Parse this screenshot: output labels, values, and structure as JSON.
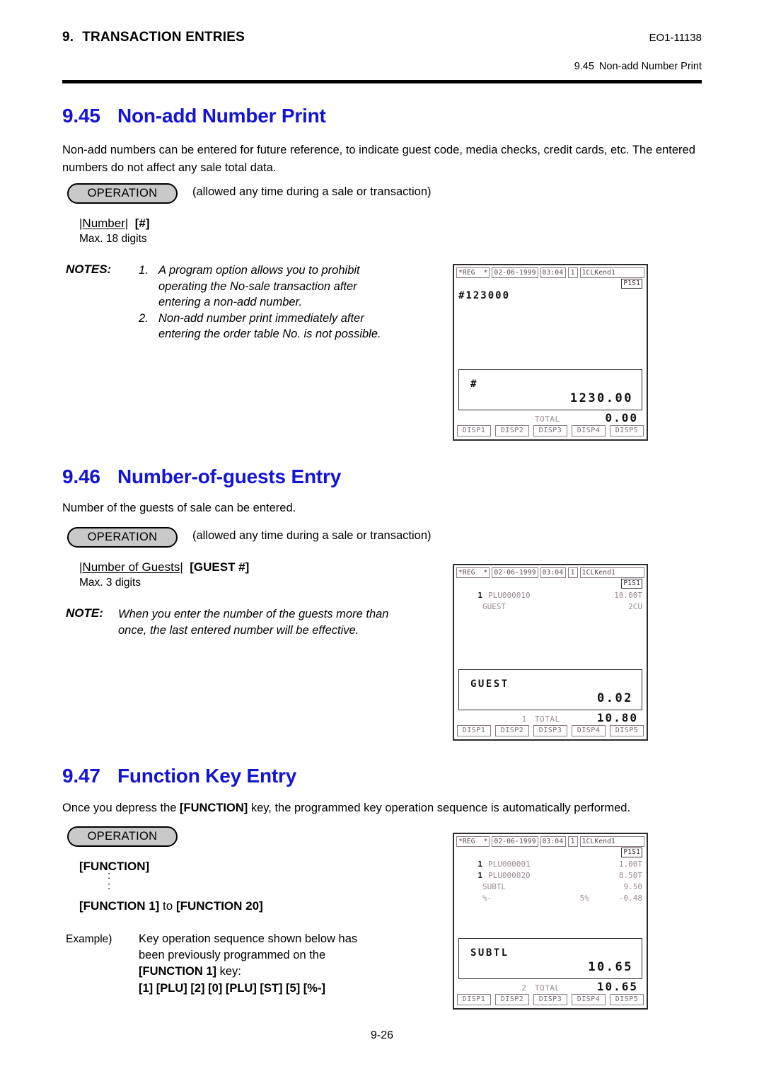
{
  "header": {
    "chapter_number": "9.",
    "chapter_title": "TRANSACTION ENTRIES",
    "doc_code": "EO1-11138",
    "running_section_number": "9.45",
    "running_section_title": "Non-add Number Print"
  },
  "sections": [
    {
      "number": "9.45",
      "title": "Non-add Number Print",
      "paragraph": "Non-add numbers can be entered for future reference, to indicate guest code, media checks, credit cards, etc. The entered numbers do not affect any sale total data.",
      "operation_label": "OPERATION",
      "operation_note": "(allowed any time during a sale or transaction)",
      "key_sequence_operand": "|Number|",
      "key_sequence_key": "[#]",
      "max_digits": "Max. 18 digits",
      "notes_label": "NOTES:",
      "notes": [
        {
          "num": "1.",
          "text": "A program option allows you to prohibit operating the No-sale transaction after entering a non-add number."
        },
        {
          "num": "2.",
          "text": "Non-add number print immediately after entering the order table No. is not possible."
        }
      ]
    },
    {
      "number": "9.46",
      "title": "Number-of-guests Entry",
      "paragraph": "Number of the guests of sale can be entered.",
      "operation_label": "OPERATION",
      "operation_note": "(allowed any time during a sale or transaction)",
      "key_sequence_operand": "|Number of Guests|",
      "key_sequence_key": "[GUEST #]",
      "max_digits": "Max. 3 digits",
      "notes_label": "NOTE:",
      "note_text": "When you enter the number of the guests more than once, the last entered number will be effective."
    },
    {
      "number": "9.47",
      "title": "Function Key Entry",
      "paragraph_pre": "Once you depress the ",
      "paragraph_bold": "[FUNCTION]",
      "paragraph_post": " key, the programmed key operation sequence is automatically performed.",
      "operation_label": "OPERATION",
      "function_key": "[FUNCTION]",
      "ellipsis": ":",
      "function_range_pre": "[FUNCTION 1]",
      "function_range_mid": " to ",
      "function_range_post": "[FUNCTION 20]",
      "example_label": "Example)",
      "example_line1": "Key operation sequence shown below has",
      "example_line2": "been previously programmed on the",
      "example_line3_bold": "[FUNCTION 1]",
      "example_line3_rest": " key:",
      "example_sequence": "[1]  [PLU]  [2]  [0]  [PLU]  [ST]  [5]  [%-]"
    }
  ],
  "displays": [
    {
      "id": "display-nonadd",
      "status": {
        "mode": "*REG  *",
        "date": "02-06-1999",
        "time": "03:04",
        "register_no": "1",
        "clerk": "1CLKend1",
        "page_station": "P1S1"
      },
      "lines": [
        {
          "type": "plain",
          "text": "#123000"
        }
      ],
      "big": {
        "left": "#",
        "right": "1230.00"
      },
      "total": {
        "qty": "",
        "label": "TOTAL",
        "value": "0.00"
      },
      "disp_buttons": [
        "DISP1",
        "DISP2",
        "DISP3",
        "DISP4",
        "DISP5"
      ]
    },
    {
      "id": "display-guest",
      "status": {
        "mode": "*REG  *",
        "date": "02-06-1999",
        "time": "03:04",
        "register_no": "1",
        "clerk": "1CLKend1",
        "page_station": "P1S1"
      },
      "lines": [
        {
          "type": "item",
          "qty": "1",
          "name": "PLU000010",
          "mid": "",
          "amount": "10.00T"
        },
        {
          "type": "label",
          "qty": "",
          "name": "GUEST",
          "mid": "",
          "amount": "2CU"
        }
      ],
      "big": {
        "left": "GUEST",
        "right": "0.02"
      },
      "total": {
        "qty": "1",
        "label": "TOTAL",
        "value": "10.80"
      },
      "disp_buttons": [
        "DISP1",
        "DISP2",
        "DISP3",
        "DISP4",
        "DISP5"
      ]
    },
    {
      "id": "display-function",
      "status": {
        "mode": "*REG  *",
        "date": "02-06-1999",
        "time": "03:04",
        "register_no": "1",
        "clerk": "1CLKend1",
        "page_station": "P1S1"
      },
      "lines": [
        {
          "type": "item",
          "qty": "1",
          "name": "PLU000001",
          "mid": "",
          "amount": "1.00T"
        },
        {
          "type": "item",
          "qty": "1",
          "name": "PLU000020",
          "mid": "",
          "amount": "8.50T"
        },
        {
          "type": "label",
          "qty": "",
          "name": "SUBTL",
          "mid": "",
          "amount": "9.50"
        },
        {
          "type": "label",
          "qty": "",
          "name": "%-",
          "mid": "5%",
          "amount": "-0.48"
        }
      ],
      "big": {
        "left": "SUBTL",
        "right": "10.65"
      },
      "total": {
        "qty": "2",
        "label": "TOTAL",
        "value": "10.65"
      },
      "disp_buttons": [
        "DISP1",
        "DISP2",
        "DISP3",
        "DISP4",
        "DISP5"
      ]
    }
  ],
  "footer": {
    "page_number": "9-26"
  },
  "colors": {
    "heading": "#1414d2",
    "pill_fill": "#c9c9c9",
    "display_text": "#9c8b95"
  }
}
